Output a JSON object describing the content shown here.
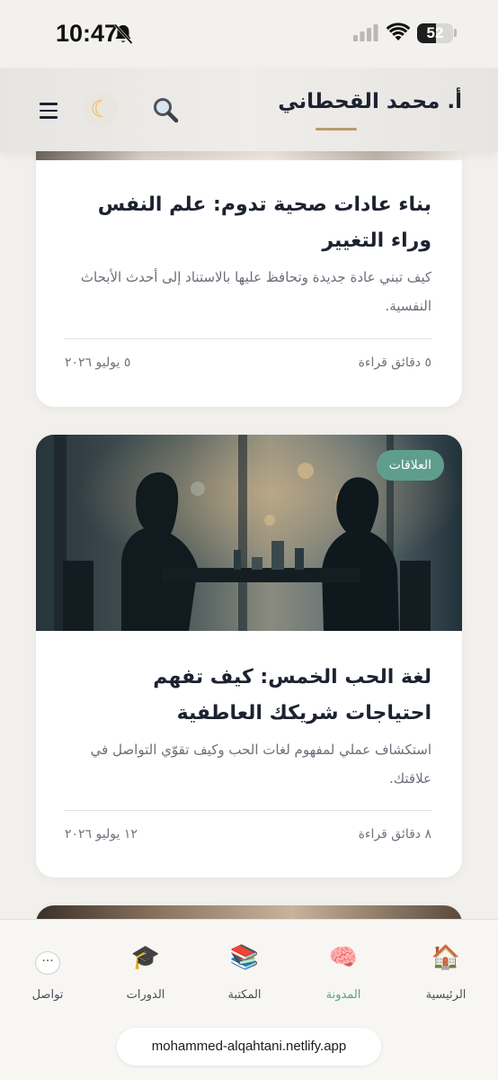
{
  "status_bar": {
    "time": "10:47",
    "battery": "52",
    "battery_level": 0.52
  },
  "header": {
    "brand": "أ. محمد القحطاني"
  },
  "articles": [
    {
      "title": "بناء عادات صحية تدوم: علم النفس وراء التغيير",
      "excerpt": "كيف تبني عادة جديدة وتحافظ عليها بالاستناد إلى أحدث الأبحاث النفسية.",
      "read_time": "٥ دقائق قراءة",
      "date": "٥ يوليو ٢٠٢٦"
    },
    {
      "category": "العلاقات",
      "title": "لغة الحب الخمس: كيف تفهم احتياجات شريكك العاطفية",
      "excerpt": "استكشاف عملي لمفهوم لغات الحب وكيف تقوّي التواصل في علاقتك.",
      "read_time": "٨ دقائق قراءة",
      "date": "١٢ يوليو ٢٠٢٦"
    }
  ],
  "bottom_nav": {
    "items": [
      {
        "label": "الرئيسية",
        "icon": "house-icon"
      },
      {
        "label": "المدونة",
        "icon": "brain-icon",
        "active": true
      },
      {
        "label": "المكتبة",
        "icon": "books-icon"
      },
      {
        "label": "الدورات",
        "icon": "graduation-cap-icon"
      },
      {
        "label": "تواصل",
        "icon": "speech-bubble-icon"
      }
    ]
  },
  "browser": {
    "url": "mohammed-alqahtani.netlify.app"
  },
  "colors": {
    "accent": "#5f9e8c",
    "brand_underline": "#b79a6f",
    "background": "#f2f0ec"
  }
}
